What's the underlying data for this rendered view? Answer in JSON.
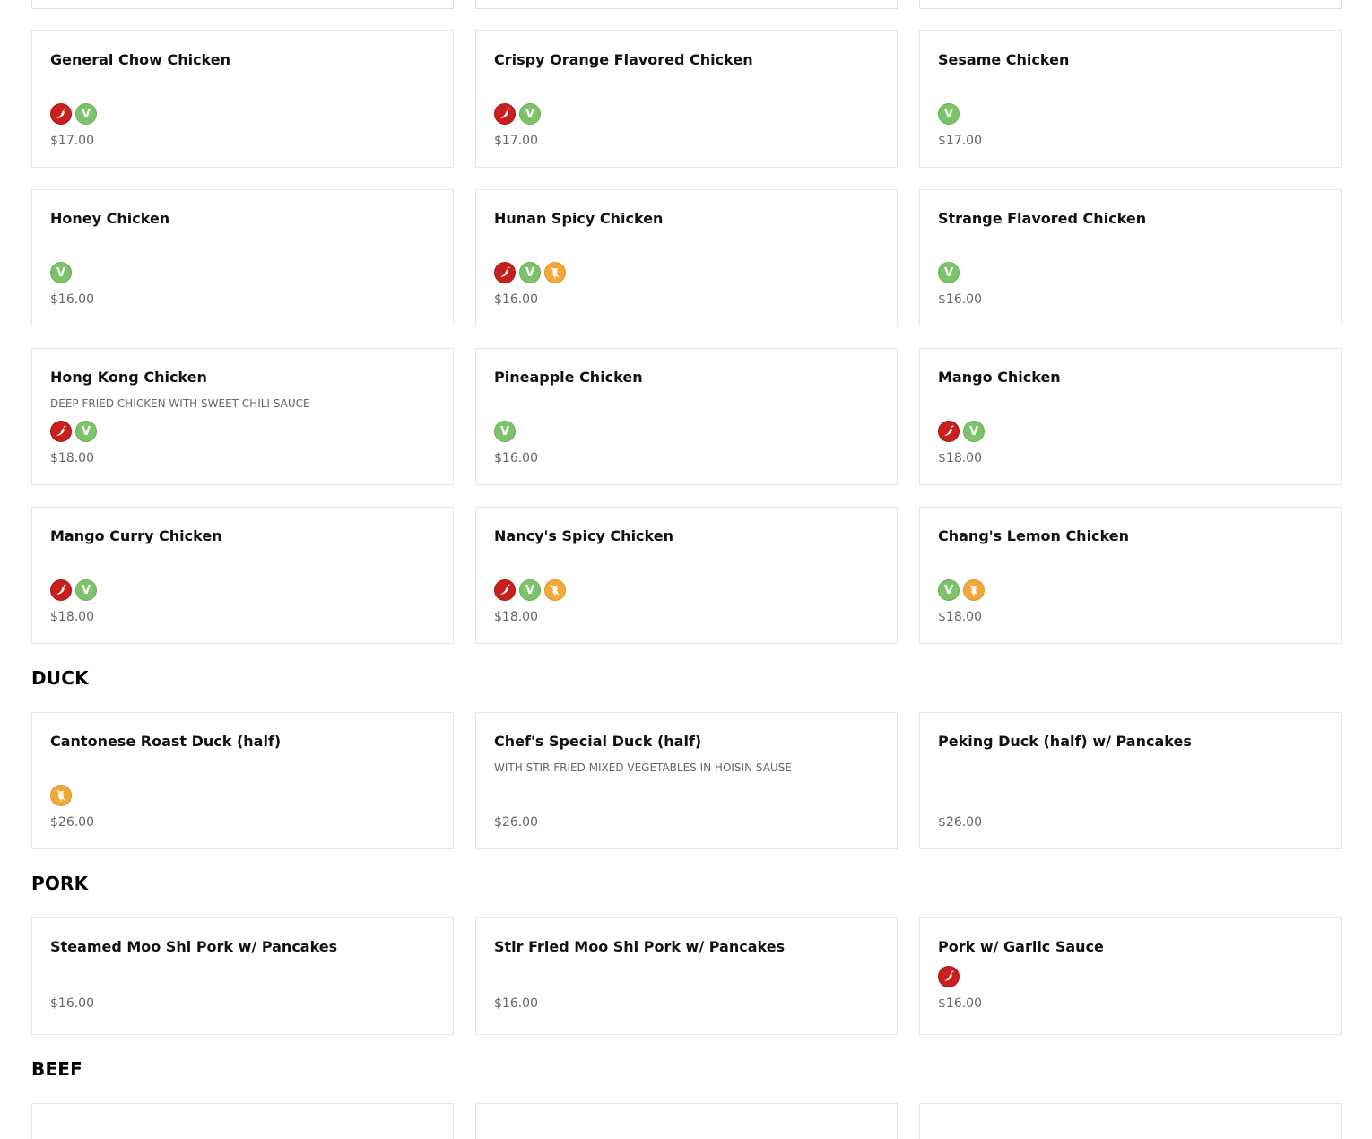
{
  "colors": {
    "spicy": "#c91f1f",
    "vegetarian": "#7cc36a",
    "gluten_free": "#f2a93b",
    "card_border": "#efe6da",
    "price_text": "#666666"
  },
  "icons": {
    "spicy": "chili-pepper-icon",
    "vegetarian": "vegetarian-v-icon",
    "gluten_free": "wheat-icon",
    "vegetarian_glyph": "V"
  },
  "chicken": {
    "items": [
      {
        "name": "General Chow Chicken",
        "desc": "",
        "icons": [
          "spicy",
          "vegetarian"
        ],
        "price": "$17.00"
      },
      {
        "name": "Crispy Orange Flavored Chicken",
        "desc": "",
        "icons": [
          "spicy",
          "vegetarian"
        ],
        "price": "$17.00"
      },
      {
        "name": "Sesame Chicken",
        "desc": "",
        "icons": [
          "vegetarian"
        ],
        "price": "$17.00"
      },
      {
        "name": "Honey Chicken",
        "desc": "",
        "icons": [
          "vegetarian"
        ],
        "price": "$16.00"
      },
      {
        "name": "Hunan Spicy Chicken",
        "desc": "",
        "icons": [
          "spicy",
          "vegetarian",
          "gluten_free"
        ],
        "price": "$16.00"
      },
      {
        "name": "Strange Flavored Chicken",
        "desc": "",
        "icons": [
          "vegetarian"
        ],
        "price": "$16.00"
      },
      {
        "name": "Hong Kong Chicken",
        "desc": "Deep fried chicken with sweet chili sauce",
        "icons": [
          "spicy",
          "vegetarian"
        ],
        "price": "$18.00"
      },
      {
        "name": "Pineapple Chicken",
        "desc": "",
        "icons": [
          "vegetarian"
        ],
        "price": "$16.00"
      },
      {
        "name": "Mango Chicken",
        "desc": "",
        "icons": [
          "spicy",
          "vegetarian"
        ],
        "price": "$18.00"
      },
      {
        "name": "Mango Curry Chicken",
        "desc": "",
        "icons": [
          "spicy",
          "vegetarian"
        ],
        "price": "$18.00"
      },
      {
        "name": "Nancy's Spicy Chicken",
        "desc": "",
        "icons": [
          "spicy",
          "vegetarian",
          "gluten_free"
        ],
        "price": "$18.00"
      },
      {
        "name": "Chang's Lemon Chicken",
        "desc": "",
        "icons": [
          "vegetarian",
          "gluten_free"
        ],
        "price": "$18.00"
      }
    ]
  },
  "duck": {
    "title": "DUCK",
    "items": [
      {
        "name": "Cantonese Roast Duck (half)",
        "desc": "",
        "icons": [
          "gluten_free"
        ],
        "price": "$26.00"
      },
      {
        "name": "Chef's Special Duck (half)",
        "desc": "With stir fried mixed vegetables in hoisin sause",
        "icons": [],
        "price": "$26.00"
      },
      {
        "name": "Peking Duck (half) w/ Pancakes",
        "desc": "",
        "icons": [],
        "price": "$26.00"
      }
    ]
  },
  "pork": {
    "title": "PORK",
    "items": [
      {
        "name": "Steamed Moo Shi Pork w/ Pancakes",
        "desc": "",
        "icons": [],
        "price": "$16.00"
      },
      {
        "name": "Stir Fried Moo Shi Pork w/ Pancakes",
        "desc": "",
        "icons": [],
        "price": "$16.00"
      },
      {
        "name": "Pork w/ Garlic Sauce",
        "desc": "",
        "icons": [
          "spicy"
        ],
        "price": "$16.00"
      }
    ]
  },
  "beef": {
    "title": "BEEF"
  }
}
